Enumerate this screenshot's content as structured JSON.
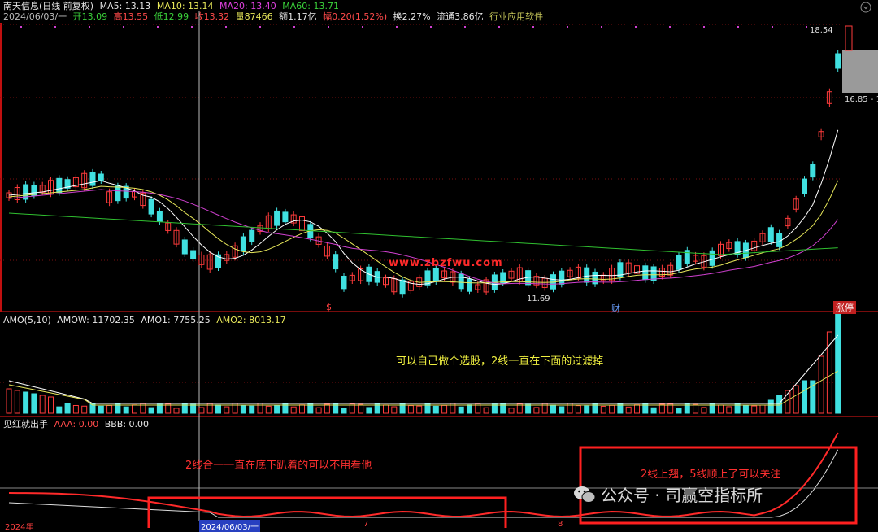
{
  "price_panel": {
    "title": "南天信息(日线 前复权)",
    "ma5": "MA5: 13.13",
    "ma10": "MA10: 13.14",
    "ma20": "MA20: 13.40",
    "ma60": "MA60: 13.71",
    "date": "2024/06/03/一",
    "open": "开13.09",
    "high": "高13.55",
    "low": "低12.99",
    "close": "收13.32",
    "volume": "量87466",
    "amount": "额1.17亿",
    "change": "幅0.20(1.52%)",
    "turnover": "换2.27%",
    "float_cap": "流通3.86亿",
    "industry": "行业应用软件",
    "price_high_label": "18.54",
    "price_mid_label": "16.85 - 1",
    "price_low_label": "11.69",
    "marker_s": "$",
    "marker_cai": "财",
    "marker_zhangting": "涨停",
    "watermark": "www.zbzfwu.com"
  },
  "amo_panel": {
    "name": "AMO(5,10)",
    "amow": "AMOW: 11702.35",
    "amo1": "AMO1: 7755.25",
    "amo2": "AMO2: 8013.17",
    "note": "可以自己做个选股，2线一直在下面的过滤掉"
  },
  "signal_panel": {
    "name": "见红就出手",
    "aaa": "AAA: 0.00",
    "bbb": "BBB: 0.00",
    "note_left": "2线合一一直在底下趴着的可以不用看他",
    "note_right": "2线上翘，5线顺上了可以关注"
  },
  "axis": {
    "year_label": "2024年",
    "cursor_date": "2024/06/03/一",
    "tick_7": "7",
    "tick_8": "8"
  },
  "branding": {
    "wechat_text": "公众号 · 司赢空指标所"
  },
  "colors": {
    "up": "#ff3b3b",
    "down": "#40e0e0",
    "ma5": "#ffffff",
    "ma10": "#e8e85a",
    "ma20": "#d040d0",
    "ma60": "#30c030",
    "annotation_box": "#ff2020"
  }
}
